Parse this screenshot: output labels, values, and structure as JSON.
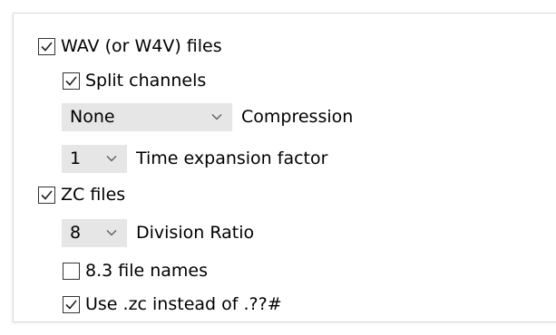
{
  "wav": {
    "checkbox_label": "WAV (or W4V) files",
    "checked": true,
    "split_channels": {
      "label": "Split channels",
      "checked": true
    },
    "compression": {
      "selected": "None",
      "label": "Compression"
    },
    "time_expansion": {
      "selected": "1",
      "label": "Time expansion factor"
    }
  },
  "zc": {
    "checkbox_label": "ZC files",
    "checked": true,
    "division_ratio": {
      "selected": "8",
      "label": "Division Ratio"
    },
    "short_names": {
      "label": "8.3 file names",
      "checked": false
    },
    "use_zc": {
      "label": "Use .zc instead of .??#",
      "checked": true
    }
  },
  "icons": {
    "check": "checkmark-icon",
    "dropdown": "chevron-down-icon"
  }
}
